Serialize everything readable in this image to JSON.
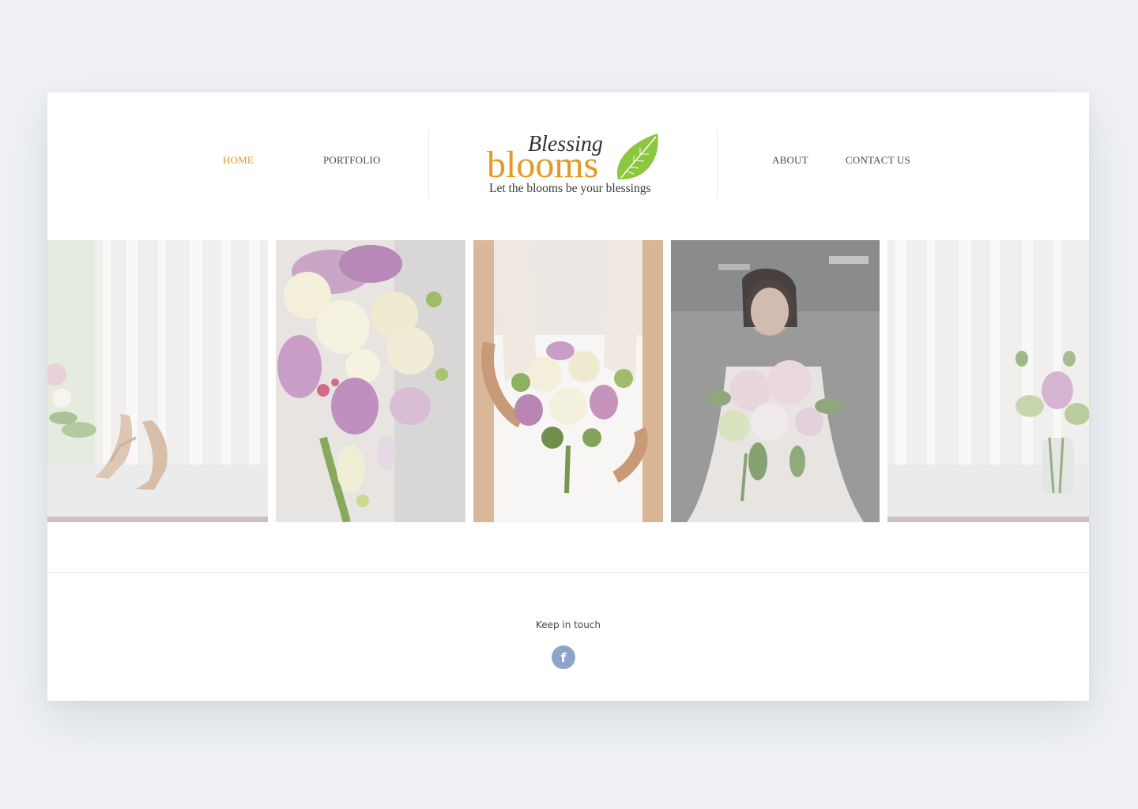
{
  "nav": {
    "left": [
      {
        "label": "HOME",
        "active": true
      },
      {
        "label": "PORTFOLIO",
        "active": false
      }
    ],
    "right": [
      {
        "label": "ABOUT",
        "active": false
      },
      {
        "label": "CONTACT US",
        "active": false
      }
    ]
  },
  "logo": {
    "script_word": "Blessing",
    "main_word": "blooms",
    "tagline": "Let the blooms be your blessings",
    "colors": {
      "main": "#e39a1f",
      "leaf": "#8dc63f",
      "script": "#333333"
    }
  },
  "gallery": {
    "items": [
      {
        "alt": "Bridal sandals on window table with flowers",
        "icon": "photo-shoes"
      },
      {
        "alt": "Cascading orchid and rose bouquet",
        "icon": "photo-cascade-bouquet"
      },
      {
        "alt": "Bride holding bouquet in lace gown",
        "icon": "photo-bride-bouquet"
      },
      {
        "alt": "Bride holding peony bouquet",
        "icon": "photo-bride-portrait"
      },
      {
        "alt": "Flower vase on window table",
        "icon": "photo-vase"
      }
    ]
  },
  "footer": {
    "keep_in_touch": "Keep in touch",
    "social": [
      {
        "name": "facebook",
        "icon": "facebook-icon",
        "glyph": "f",
        "color": "#8da4c8"
      }
    ]
  },
  "colors": {
    "accent": "#d99a2b",
    "page_bg": "#eff1f4",
    "card_bg": "#ffffff"
  }
}
